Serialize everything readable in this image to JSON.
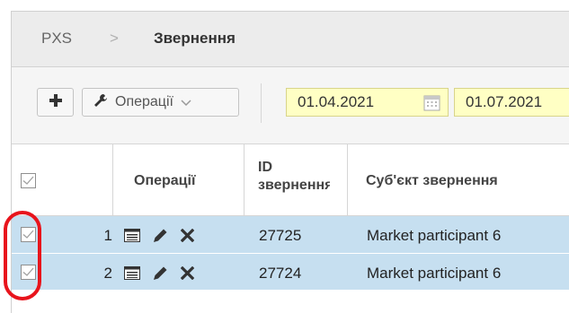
{
  "breadcrumb": {
    "root": "PXS",
    "separator": ">",
    "current": "Звернення"
  },
  "toolbar": {
    "operations_label": "Операції",
    "date_from": "01.04.2021",
    "date_to": "01.07.2021"
  },
  "table": {
    "columns": {
      "operations": "Операції",
      "id_line1": "ID",
      "id_line2": "звернення",
      "subject": "Суб'єкт звернення"
    },
    "rows": [
      {
        "num": "1",
        "id": "27725",
        "subject": "Market participant 6",
        "checked": true
      },
      {
        "num": "2",
        "id": "27724",
        "subject": "Market participant 6",
        "checked": true
      }
    ]
  },
  "colors": {
    "row_selected": "#c6dff0",
    "date_field": "#ffffc4",
    "highlight": "#e8141c"
  },
  "icons": [
    "plus-icon",
    "wrench-icon",
    "chevron-down-icon",
    "calendar-icon",
    "list-icon",
    "pencil-icon",
    "close-icon",
    "checkbox-icon"
  ]
}
